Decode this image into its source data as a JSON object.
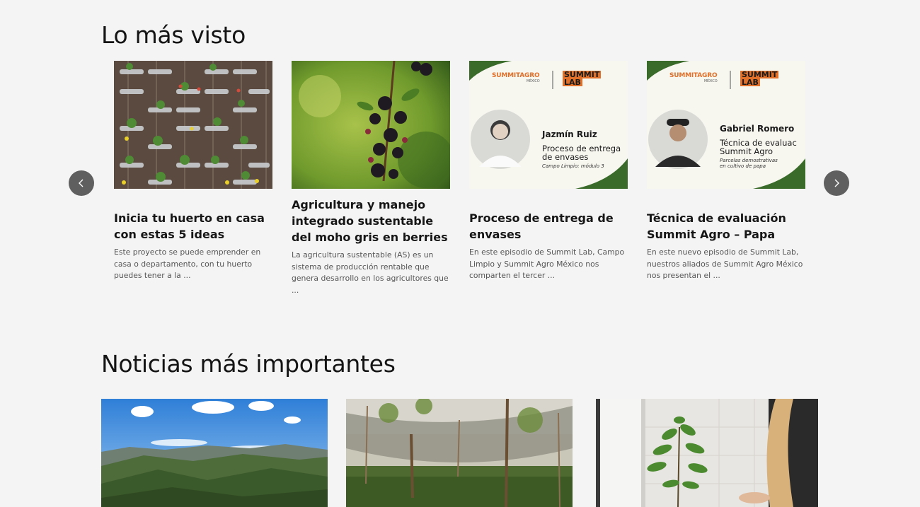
{
  "sections": {
    "most_viewed_title": "Lo más visto",
    "top_news_title": "Noticias más importantes"
  },
  "carousel": {
    "prev_icon": "chevron-left-icon",
    "next_icon": "chevron-right-icon",
    "cards": [
      {
        "title": "Inicia tu huerto en casa con estas 5 ideas",
        "excerpt": "Este proyecto se puede emprender en casa o departamento, con tu huerto puedes tener a la ..."
      },
      {
        "title": "Agricultura y manejo integrado sustentable del moho gris en berries",
        "excerpt": "La agricultura sustentable (AS) es un sistema de producción rentable que genera desarrollo en los agricultores que ..."
      },
      {
        "title": "Proceso de entrega de envases",
        "excerpt": "En este episodio de Summit Lab, Campo Limpio y Summit Agro México nos comparten el tercer ...",
        "thumb": {
          "brand_1": "SUMMITAGRO",
          "brand_1_sub": "MÉXICO",
          "brand_2a": "SUMMIT",
          "brand_2b": "LAB",
          "person": "Jazmín Ruiz",
          "line1": "Proceso de entrega",
          "line2": "de envases",
          "caption": "Campo Limpio: módulo 3"
        }
      },
      {
        "title": "Técnica de evaluación Summit Agro – Papa",
        "excerpt": "En este nuevo episodio de Summit Lab, nuestros aliados de Summit Agro México nos presentan el ...",
        "thumb": {
          "brand_1": "SUMMITAGRO",
          "brand_1_sub": "MÉXICO",
          "brand_2a": "SUMMIT",
          "brand_2b": "LAB",
          "person": "Gabriel Romero",
          "line1": "Técnica de evaluac",
          "line2": "Summit Agro",
          "caption": "Parcelas demostrativas",
          "caption2": "en cultivo de papa"
        }
      }
    ]
  },
  "colors": {
    "background": "#f4f4f4",
    "brand_green": "#3a6b2a",
    "brand_orange": "#e0702a",
    "arrow_bg": "#5f5f5f"
  }
}
